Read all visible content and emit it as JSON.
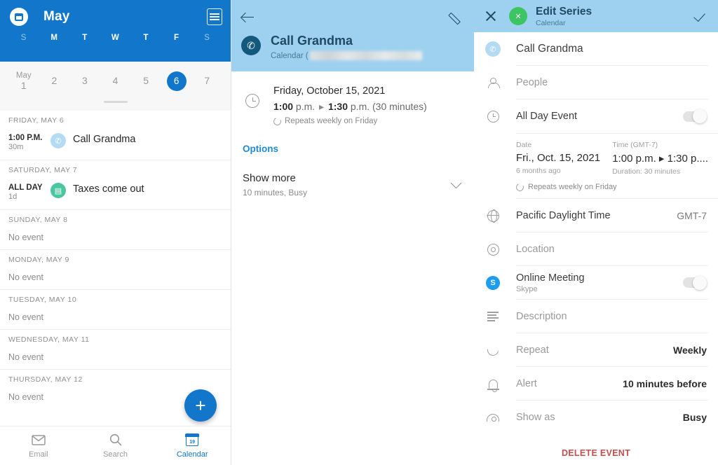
{
  "agenda": {
    "app_icon": "calendar-avatar-icon",
    "month_title": "May",
    "agenda_view_icon": "agenda-list-icon",
    "weekday_initials": [
      "S",
      "M",
      "T",
      "W",
      "T",
      "F",
      "S"
    ],
    "week_dates": [
      {
        "month": "May",
        "day": "1",
        "selected": false
      },
      {
        "month": "",
        "day": "2",
        "selected": false
      },
      {
        "month": "",
        "day": "3",
        "selected": false
      },
      {
        "month": "",
        "day": "4",
        "selected": false
      },
      {
        "month": "",
        "day": "5",
        "selected": false
      },
      {
        "month": "",
        "day": "6",
        "selected": true
      },
      {
        "month": "",
        "day": "7",
        "selected": false
      }
    ],
    "sections": [
      {
        "header": "FRIDAY, MAY 6",
        "type": "event",
        "time": "1:00 P.M.",
        "duration": "30m",
        "icon": "phone-icon",
        "title": "Call Grandma"
      },
      {
        "header": "SATURDAY, MAY 7",
        "type": "event",
        "time": "ALL DAY",
        "duration": "1d",
        "icon": "money-icon",
        "title": "Taxes come out"
      },
      {
        "header": "SUNDAY, MAY 8",
        "type": "empty",
        "empty_text": "No event"
      },
      {
        "header": "MONDAY, MAY 9",
        "type": "empty",
        "empty_text": "No event"
      },
      {
        "header": "TUESDAY, MAY 10",
        "type": "empty",
        "empty_text": "No event"
      },
      {
        "header": "WEDNESDAY, MAY 11",
        "type": "empty",
        "empty_text": "No event"
      },
      {
        "header": "THURSDAY, MAY 12",
        "type": "empty",
        "empty_text": "No event"
      }
    ],
    "fab_label": "+",
    "bottom_nav": [
      {
        "label": "Email",
        "icon": "mail-icon",
        "active": false
      },
      {
        "label": "Search",
        "icon": "search-icon",
        "active": false
      },
      {
        "label": "Calendar",
        "icon": "calendar-icon",
        "active": true,
        "day_number": "19"
      }
    ],
    "colors": {
      "header_blue": "#1277cb",
      "selected_day": "#1277cb",
      "accent": "#1277cb"
    }
  },
  "detail": {
    "back_icon": "back-arrow-icon",
    "edit_icon": "pencil-icon",
    "event_icon": "phone-icon",
    "title": "Call Grandma",
    "calendar_prefix": "Calendar (",
    "clock_icon": "clock-icon",
    "date": "Friday, October 15, 2021",
    "time_start": "1:00",
    "time_start_suffix": "p.m.",
    "time_arrow": "▸",
    "time_end": "1:30",
    "time_end_suffix": "p.m.",
    "time_duration": "(30 minutes)",
    "repeat_icon": "repeat-icon",
    "repeat_text": "Repeats weekly on Friday",
    "options_label": "Options",
    "show_more_label": "Show more",
    "show_more_sub": "10 minutes, Busy",
    "chevron_icon": "chevron-down-icon",
    "colors": {
      "header_blue": "#9ed1ef",
      "title_navy": "#1f4a63",
      "link_blue": "#1f8ad1"
    }
  },
  "edit": {
    "close_icon": "close-icon",
    "avatar_icon": "contact-avatar-icon",
    "header_title": "Edit Series",
    "header_sub": "Calendar",
    "confirm_icon": "check-icon",
    "event_icon": "phone-icon",
    "event_title": "Call Grandma",
    "rows": [
      {
        "icon": "people-icon",
        "label": "People",
        "value": "",
        "control": "none"
      },
      {
        "icon": "clock-icon",
        "label": "All Day Event",
        "value": "",
        "control": "toggle",
        "toggle_on": false
      }
    ],
    "datetime": {
      "date_label": "Date",
      "date_value": "Fri., Oct. 15, 2021",
      "date_sub": "6 months ago",
      "time_label": "Time (GMT-7)",
      "time_value": "1:00 p.m. ▸ 1:30 p....",
      "time_sub": "Duration: 30 minutes",
      "repeat_icon": "repeat-icon",
      "repeat_text": "Repeats weekly on Friday"
    },
    "rows2": [
      {
        "icon": "globe-icon",
        "label": "Pacific Daylight Time",
        "label_dark": true,
        "value": "GMT-7",
        "value_light": true,
        "control": "none"
      },
      {
        "icon": "location-pin-icon",
        "label": "Location",
        "value": "",
        "control": "none"
      },
      {
        "icon": "skype-icon",
        "label": "Online Meeting",
        "label_dark": true,
        "sub": "Skype",
        "value": "",
        "control": "toggle",
        "toggle_on": false
      },
      {
        "icon": "description-icon",
        "label": "Description",
        "value": "",
        "control": "none"
      },
      {
        "icon": "repeat-icon",
        "label": "Repeat",
        "value": "Weekly",
        "control": "none"
      },
      {
        "icon": "bell-icon",
        "label": "Alert",
        "value": "10 minutes before",
        "control": "none"
      },
      {
        "icon": "eye-icon",
        "label": "Show as",
        "value": "Busy",
        "control": "none"
      }
    ],
    "delete_label": "DELETE EVENT",
    "colors": {
      "header_blue": "#9ed1ef",
      "avatar_green": "#3dc463",
      "delete_red": "#c0504d",
      "skype_blue": "#1b9df0"
    }
  }
}
